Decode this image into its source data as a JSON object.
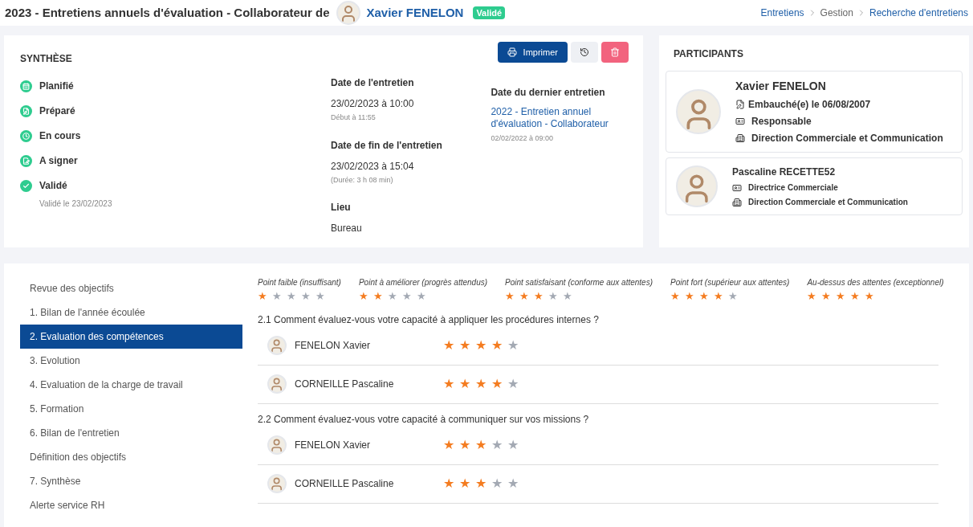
{
  "header": {
    "title": "2023 - Entretiens annuels d'évaluation - Collaborateur de",
    "person": "Xavier FENELON",
    "badge": "Validé",
    "breadcrumbs": [
      "Entretiens",
      "Gestion",
      "Recherche d'entretiens"
    ]
  },
  "synthese": {
    "title": "SYNTHÈSE",
    "buttons": {
      "print": "Imprimer"
    },
    "steps": [
      {
        "label": "Planifié",
        "done": true
      },
      {
        "label": "Préparé",
        "done": true
      },
      {
        "label": "En cours",
        "done": true
      },
      {
        "label": "A signer",
        "done": true
      },
      {
        "label": "Validé",
        "done": true,
        "note": "Validé le 23/02/2023"
      }
    ],
    "dates": [
      {
        "label": "Date de l'entretien",
        "value": "23/02/2023 à 10:00",
        "note": "Début à 11:55"
      },
      {
        "label": "Date de fin de l'entretien",
        "value": "23/02/2023 à 15:04",
        "note": "(Durée: 3 h 08 min)"
      },
      {
        "label": "Lieu",
        "value": "Bureau"
      }
    ],
    "last": {
      "label": "Date du dernier entretien",
      "link": "2022 - Entretien annuel d'évaluation - Collaborateur",
      "note": "02/02/2022 à 09:00"
    }
  },
  "participants": {
    "title": "PARTICIPANTS",
    "items": [
      {
        "name": "Xavier FENELON",
        "primary": true,
        "hired": "Embauché(e) le 06/08/2007",
        "role": "Responsable",
        "dept": "Direction Commerciale et Communication"
      },
      {
        "name": "Pascaline RECETTE52",
        "primary": false,
        "role": "Directrice Commerciale",
        "dept": "Direction Commerciale et Communication"
      }
    ]
  },
  "nav": [
    {
      "label": "Revue des objectifs",
      "selected": false
    },
    {
      "label": "1. Bilan de l'année écoulée",
      "selected": false
    },
    {
      "label": "2. Evaluation des compétences",
      "selected": true
    },
    {
      "label": "3. Evolution",
      "selected": false
    },
    {
      "label": "4. Evaluation de la charge de travail",
      "selected": false
    },
    {
      "label": "5. Formation",
      "selected": false
    },
    {
      "label": "6. Bilan de l'entretien",
      "selected": false
    },
    {
      "label": "Définition des objectifs",
      "selected": false
    },
    {
      "label": "7. Synthèse",
      "selected": false
    },
    {
      "label": "Alerte service RH",
      "selected": false
    }
  ],
  "legend": [
    {
      "label": "Point faible (insuffisant)",
      "stars": 1
    },
    {
      "label": "Point à améliorer (progrès attendus)",
      "stars": 2
    },
    {
      "label": "Point satisfaisant (conforme aux attentes)",
      "stars": 3
    },
    {
      "label": "Point fort (supérieur aux attentes)",
      "stars": 4
    },
    {
      "label": "Au-dessus des attentes (exceptionnel)",
      "stars": 5
    }
  ],
  "questions": [
    {
      "title": "2.1 Comment évaluez-vous votre capacité à appliquer les procédures internes ?",
      "ratings": [
        {
          "name": "FENELON Xavier",
          "stars": 4
        },
        {
          "name": "CORNEILLE Pascaline",
          "stars": 4
        }
      ]
    },
    {
      "title": "2.2 Comment évaluez-vous votre capacité à communiquer sur vos missions ?",
      "ratings": [
        {
          "name": "FENELON Xavier",
          "stars": 3
        },
        {
          "name": "CORNEILLE Pascaline",
          "stars": 3
        }
      ]
    }
  ]
}
